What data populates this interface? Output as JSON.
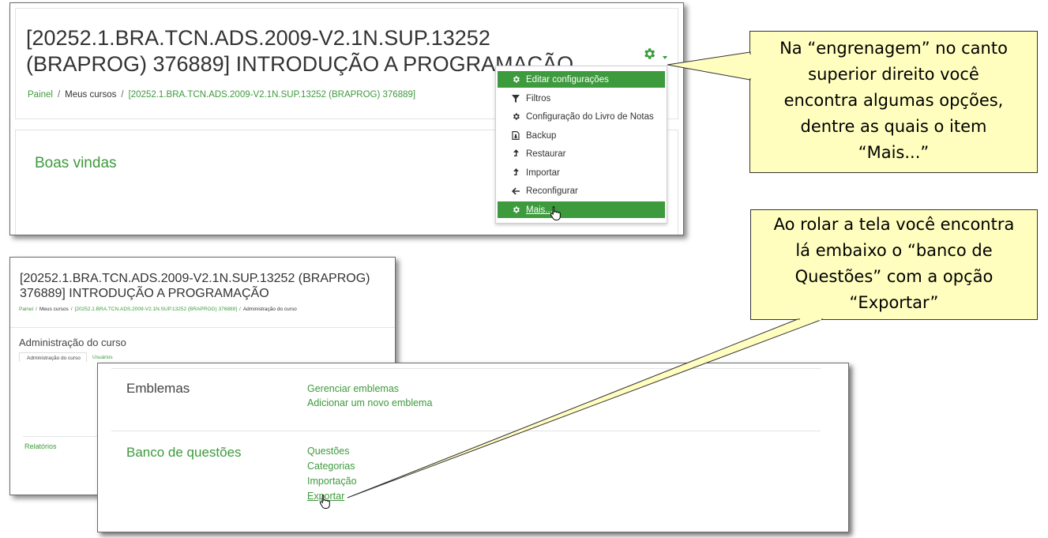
{
  "top_panel": {
    "course_title": "[20252.1.BRA.TCN.ADS.2009-V2.1N.SUP.13252 (BRAPROG) 376889] INTRODUÇÃO A PROGRAMAÇÃO",
    "breadcrumb": [
      "Painel",
      "Meus cursos",
      "[20252.1.BRA.TCN.ADS.2009-V2.1N.SUP.13252 (BRAPROG) 376889]"
    ],
    "welcome": "Boas vindas",
    "gear_icon": "gear-icon",
    "menu": [
      {
        "label": "Editar configurações",
        "icon": "gear-icon",
        "active": true
      },
      {
        "label": "Filtros",
        "icon": "filter-icon"
      },
      {
        "label": "Configuração do Livro de Notas",
        "icon": "gear-icon"
      },
      {
        "label": "Backup",
        "icon": "backup-icon"
      },
      {
        "label": "Restaurar",
        "icon": "upload-icon"
      },
      {
        "label": "Importar",
        "icon": "upload-icon"
      },
      {
        "label": "Reconfigurar",
        "icon": "arrow-left-icon"
      },
      {
        "label": "Mais...",
        "icon": "gear-icon",
        "active": true
      }
    ]
  },
  "callouts": {
    "c1": [
      "Na “engrenagem” no canto",
      "superior direito você",
      "encontra algumas opções,",
      "dentre as quais o item",
      "“Mais...”"
    ],
    "c2": [
      "Ao rolar a tela você encontra",
      "lá embaixo o “banco de",
      "Questões” com a opção",
      "“Exportar”"
    ]
  },
  "mid_panel": {
    "course_title": "[20252.1.BRA.TCN.ADS.2009-V2.1N.SUP.13252 (BRAPROG) 376889] INTRODUÇÃO A PROGRAMAÇÃO",
    "breadcrumb": [
      "Painel",
      "Meus cursos",
      "[20252.1.BRA.TCN.ADS.2009-V2.1N.SUP.13252 (BRAPROG) 376889]",
      "Administração do curso"
    ],
    "heading": "Administração do curso",
    "tabs": [
      "Administração do curso",
      "Usuários"
    ],
    "reports": "Relatórios"
  },
  "bottom_panel": {
    "section1": "Emblemas",
    "section1_links": [
      "Gerenciar emblemas",
      "Adicionar um novo emblema"
    ],
    "section2": "Banco de questões",
    "section2_links": [
      "Questões",
      "Categorias",
      "Importação",
      "Exportar"
    ]
  },
  "colors": {
    "accent": "#3d9a3d",
    "callout_bg": "#fffebf"
  }
}
